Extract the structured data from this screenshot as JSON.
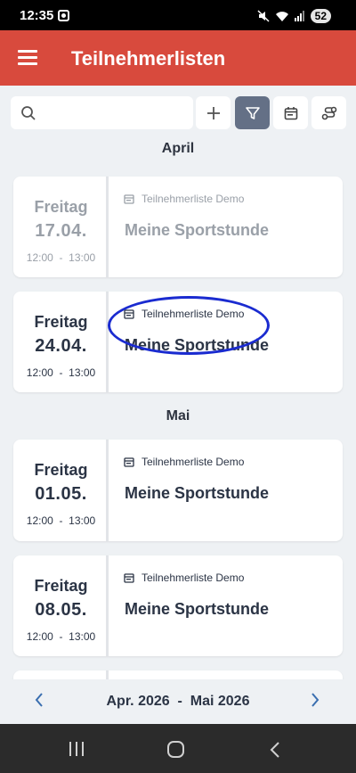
{
  "status": {
    "time": "12:35",
    "battery": "52"
  },
  "appbar": {
    "title": "Teilnehmerlisten"
  },
  "search": {
    "placeholder": "",
    "value": ""
  },
  "sections": [
    {
      "month": "April"
    },
    {
      "month": "Mai"
    }
  ],
  "events": [
    {
      "day": "Freitag",
      "date": "17.04.",
      "start": "12:00",
      "end": "13:00",
      "list": "Teilnehmerliste Demo",
      "name": "Meine Sportstunde",
      "past": true
    },
    {
      "day": "Freitag",
      "date": "24.04.",
      "start": "12:00",
      "end": "13:00",
      "list": "Teilnehmerliste Demo",
      "name": "Meine Sportstunde",
      "past": false
    },
    {
      "day": "Freitag",
      "date": "01.05.",
      "start": "12:00",
      "end": "13:00",
      "list": "Teilnehmerliste Demo",
      "name": "Meine Sportstunde",
      "past": false
    },
    {
      "day": "Freitag",
      "date": "08.05.",
      "start": "12:00",
      "end": "13:00",
      "list": "Teilnehmerliste Demo",
      "name": "Meine Sportstunde",
      "past": false
    }
  ],
  "footer": {
    "range_start": "Apr. 2026",
    "separator": "-",
    "range_end": "Mai 2026"
  },
  "colors": {
    "appbar": "#d84a3d",
    "active_filter": "#647086",
    "annotation": "#1a2bd0"
  }
}
